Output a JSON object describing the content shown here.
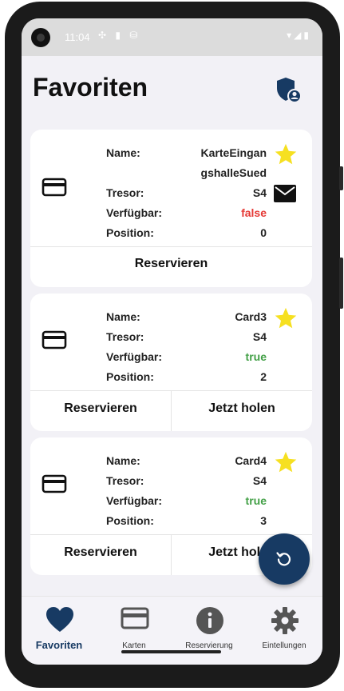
{
  "status_bar": {
    "time": "11:04",
    "left_icons": "✣ ▮ ⛁",
    "right_icons": "▾◢▮"
  },
  "header": {
    "title": "Favoriten",
    "shield_icon": "shield-user-icon"
  },
  "labels": {
    "name": "Name:",
    "tresor": "Tresor:",
    "verfuegbar": "Verfügbar:",
    "position": "Position:"
  },
  "cards": [
    {
      "name_line1": "KarteEingan",
      "name_line2": "gshalleSued",
      "tresor": "S4",
      "available": "false",
      "available_color": "#e53935",
      "position": "0",
      "actions": [
        "Reservieren"
      ]
    },
    {
      "name": "Card3",
      "tresor": "S4",
      "available": "true",
      "available_color": "#43a047",
      "position": "2",
      "actions": [
        "Reservieren",
        "Jetzt holen"
      ]
    },
    {
      "name": "Card4",
      "tresor": "S4",
      "available": "true",
      "available_color": "#43a047",
      "position": "3",
      "actions": [
        "Reservieren",
        "Jetzt holen"
      ]
    }
  ],
  "nav": [
    {
      "label": "Favoriten",
      "icon": "heart-icon",
      "active": true
    },
    {
      "label": "Karten",
      "icon": "card-icon"
    },
    {
      "label": "Reservierung",
      "icon": "info-icon"
    },
    {
      "label": "Eintellungen",
      "icon": "gear-icon"
    }
  ],
  "colors": {
    "accent": "#173a63",
    "star": "#f6e021",
    "background": "#f2f1f6"
  }
}
